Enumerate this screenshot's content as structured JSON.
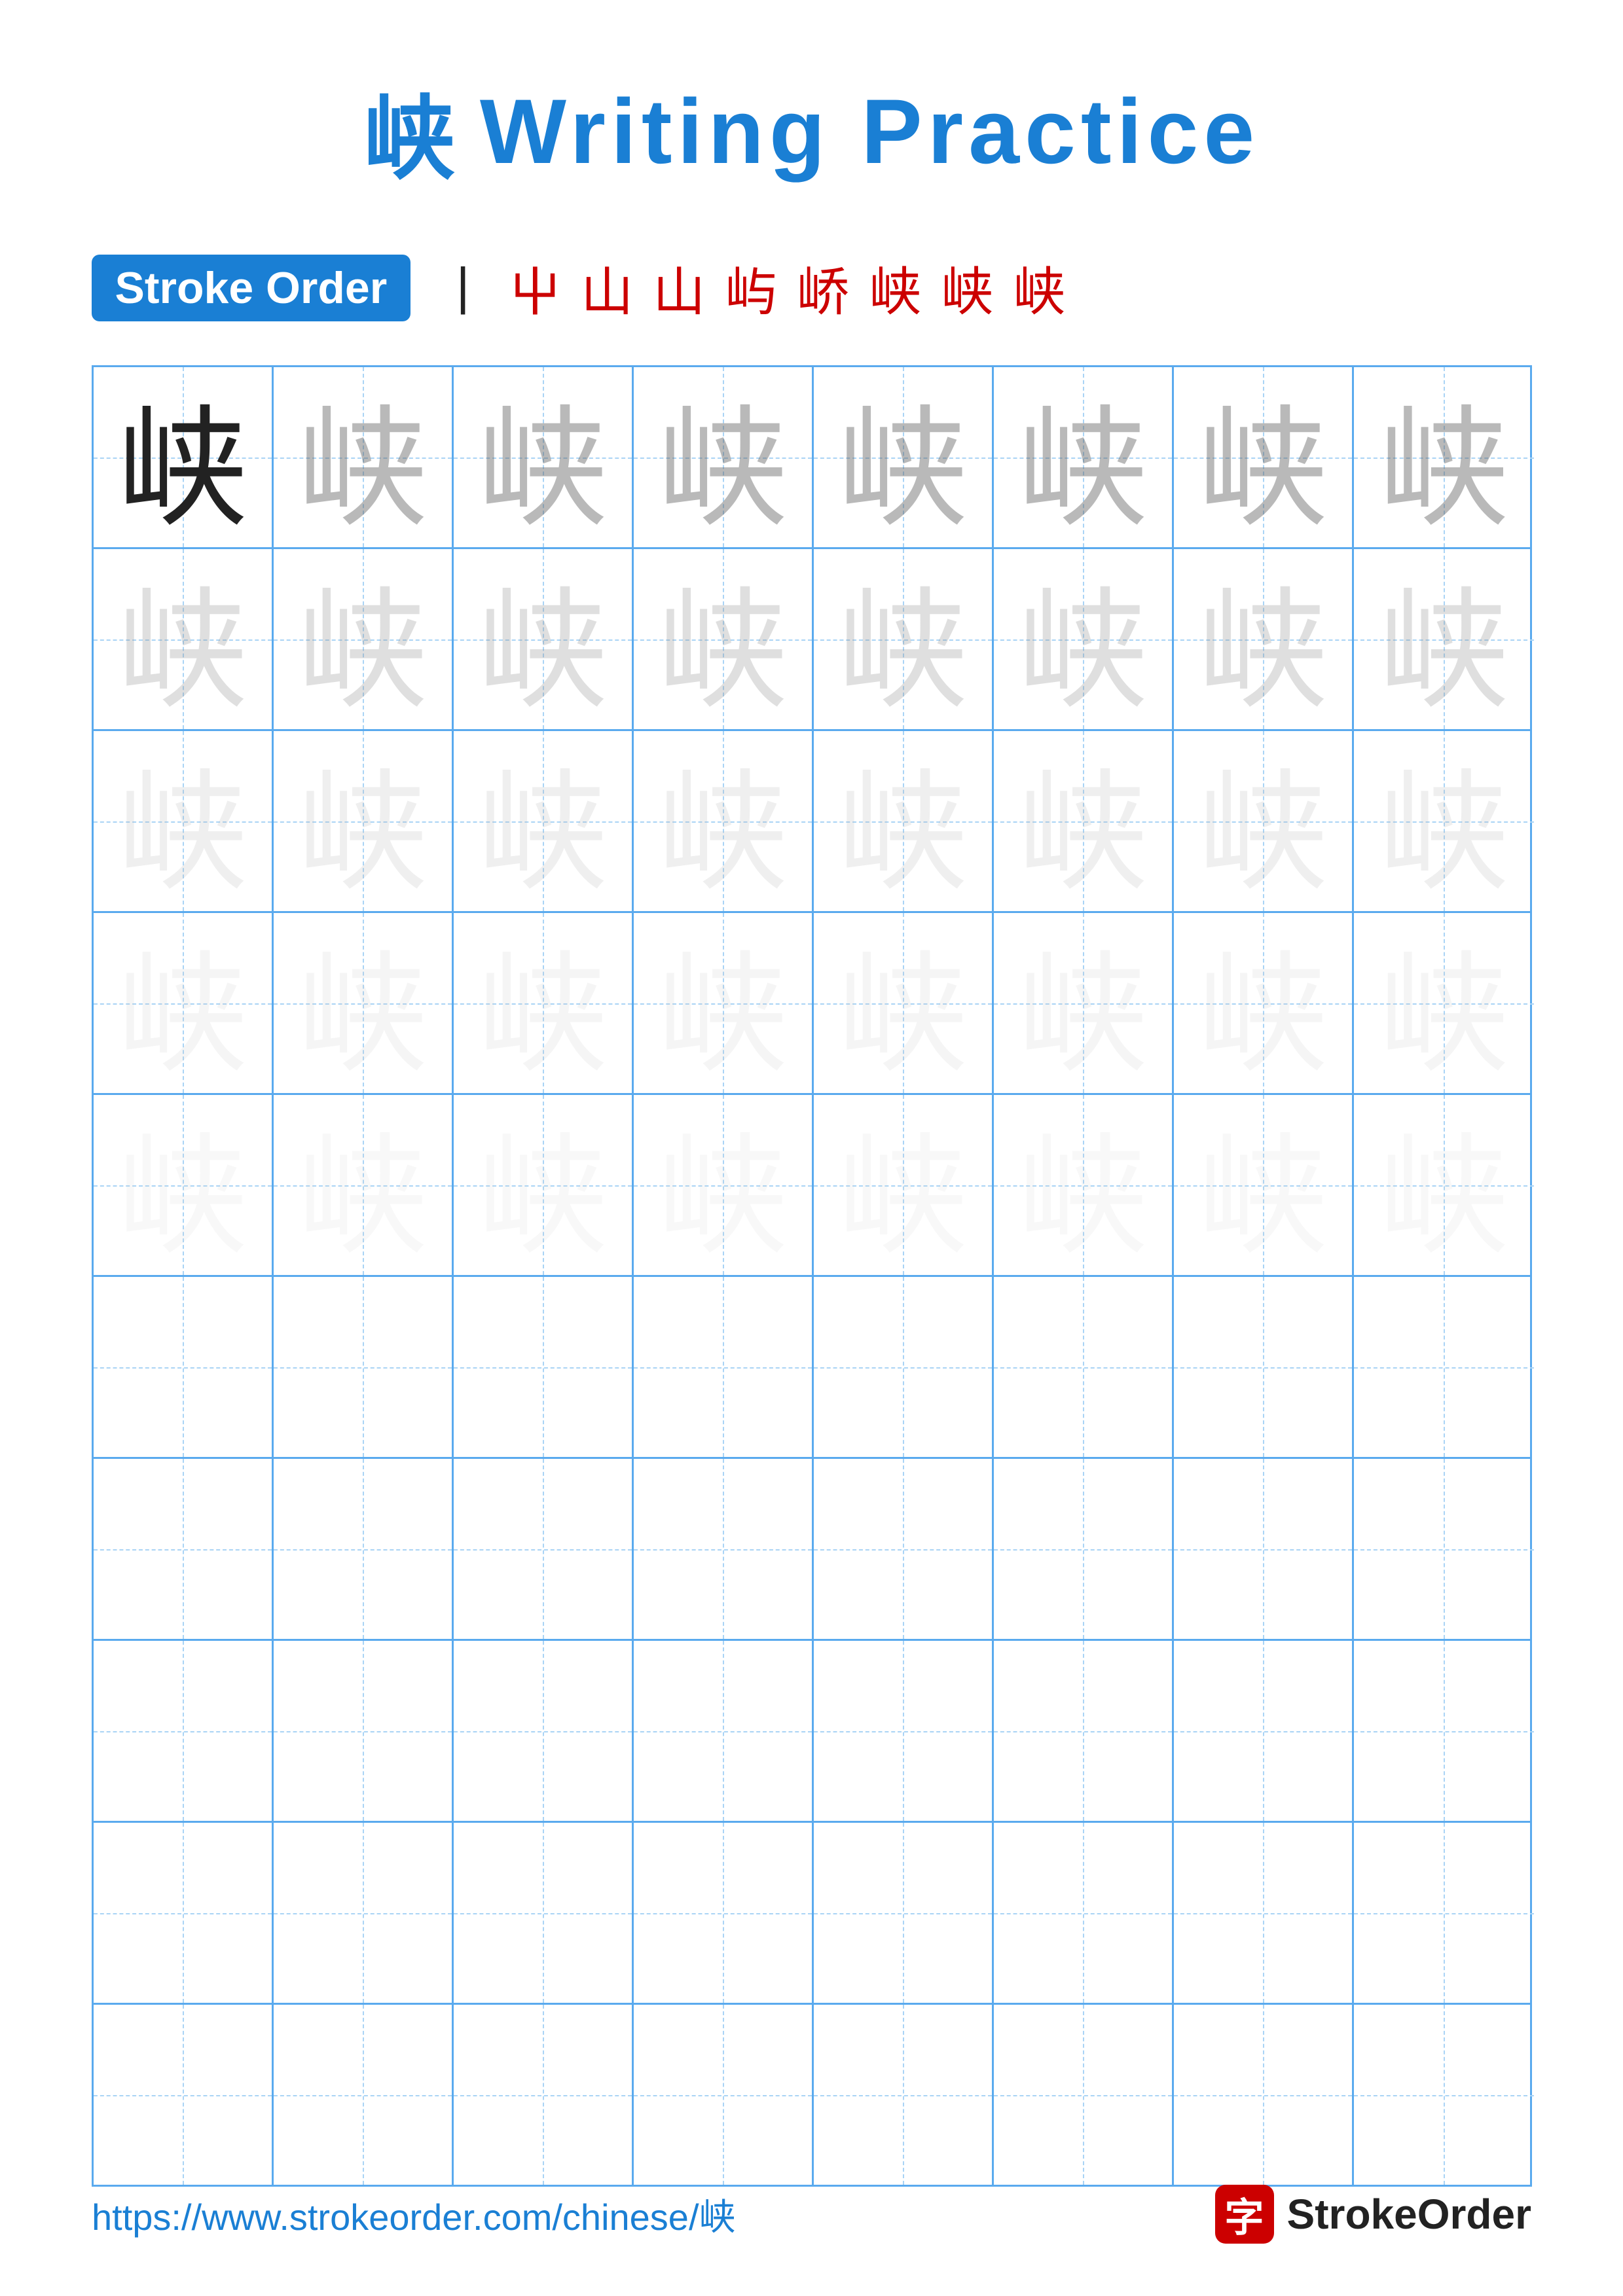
{
  "title": {
    "char": "峡",
    "text": "Writing Practice"
  },
  "stroke_order": {
    "badge_label": "Stroke Order",
    "steps": [
      "丨",
      "屮",
      "山",
      "山⁻",
      "屿",
      "峤",
      "峡̃",
      "峡̈",
      "峡"
    ]
  },
  "grid": {
    "rows": 10,
    "cols": 8,
    "char": "峡",
    "filled_rows": 5,
    "empty_rows": 5
  },
  "footer": {
    "url": "https://www.strokeorder.com/chinese/峡",
    "brand_char": "字",
    "brand_name": "StrokeOrder"
  }
}
